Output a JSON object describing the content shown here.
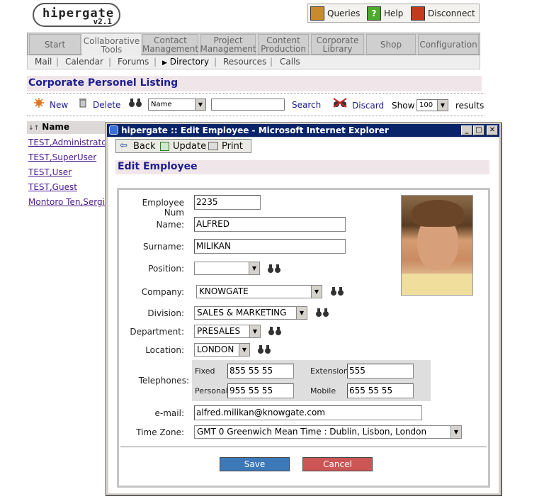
{
  "brand": {
    "name": "hipergate",
    "version": "v2.1"
  },
  "topbar": {
    "queries": "Queries",
    "help": "Help",
    "disconnect": "Disconnect"
  },
  "tabs": [
    {
      "label_1": "Start",
      "label_2": ""
    },
    {
      "label_1": "Collaborative",
      "label_2": "Tools"
    },
    {
      "label_1": "Contact",
      "label_2": "Management"
    },
    {
      "label_1": "Project",
      "label_2": "Management"
    },
    {
      "label_1": "Content",
      "label_2": "Production"
    },
    {
      "label_1": "Corporate",
      "label_2": "Library"
    },
    {
      "label_1": "Shop",
      "label_2": ""
    },
    {
      "label_1": "Configuration",
      "label_2": ""
    }
  ],
  "subnav": {
    "items": [
      "Mail",
      "Calendar",
      "Forums",
      "Directory",
      "Resources",
      "Calls"
    ],
    "active": "Directory"
  },
  "page": {
    "title": "Corporate Personel Listing"
  },
  "toolbar": {
    "new": "New",
    "delete": "Delete",
    "field_select": "Name",
    "search_value": "",
    "search": "Search",
    "discard": "Discard",
    "show": "Show",
    "show_count": "100",
    "results": "results"
  },
  "listing": {
    "header": "Name",
    "rows": [
      "TEST,Administrator",
      "TEST,SuperUser",
      "TEST,User",
      "TEST,Guest",
      "Montoro Ten,Sergio"
    ]
  },
  "dialog": {
    "window_title": "hipergate :: Edit Employee - Microsoft Internet Explorer",
    "back": "Back",
    "update": "Update",
    "print": "Print",
    "heading": "Edit Employee",
    "labels": {
      "employee_num": "Employee Num",
      "name": "Name:",
      "surname": "Surname:",
      "position": "Position:",
      "company": "Company:",
      "division": "Division:",
      "department": "Department:",
      "location": "Location:",
      "telephones": "Telephones:",
      "fixed": "Fixed",
      "extension": "Extension",
      "personal": "Personal",
      "mobile": "Mobile",
      "email": "e-mail:",
      "timezone": "Time Zone:"
    },
    "values": {
      "employee_num": "2235",
      "name": "ALFRED",
      "surname": "MILIKAN",
      "position": "",
      "company": "KNOWGATE",
      "division": "SALES & MARKETING",
      "department": "PRESALES",
      "location": "LONDON",
      "fixed": "855 55 55",
      "extension": "555",
      "personal": "955 55 55",
      "mobile": "655 55 55",
      "email": "alfred.milikan@knowgate.com",
      "timezone": "GMT 0 Greenwich Mean Time : Dublin, Lisbon, London"
    },
    "save": "Save",
    "cancel": "Cancel"
  },
  "colors": {
    "accent_title": "#1f1f8f",
    "title_bg": "#f0e6ea",
    "save": "#3d78b8",
    "cancel": "#cc5555",
    "titlebar": "#0a246a"
  }
}
